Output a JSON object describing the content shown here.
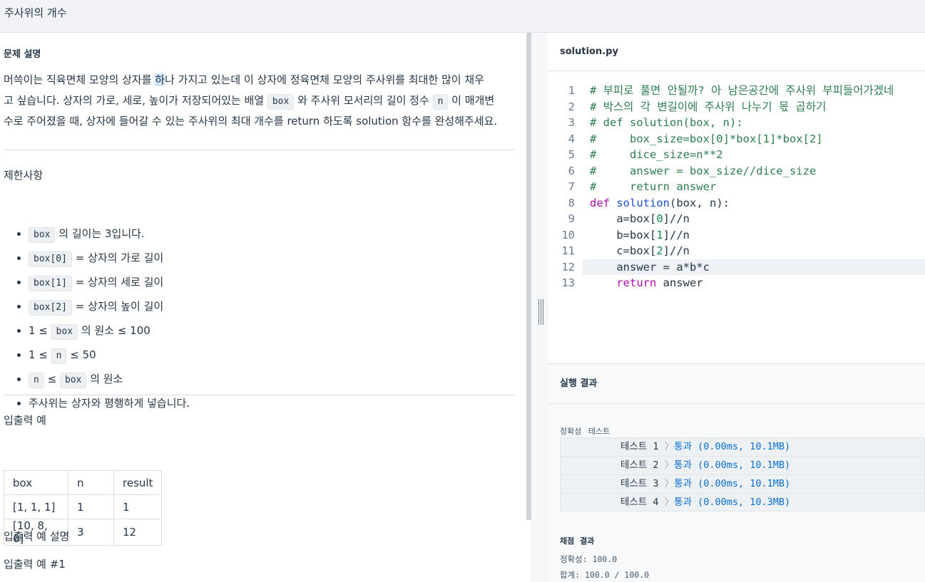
{
  "header": {
    "title": "주사위의 개수"
  },
  "problem": {
    "section_title": "문제 설명",
    "desc": {
      "p1a": "머쓱이는 직육면체 모양의 상자를 ",
      "p1hl": "하",
      "p1b": "나 가지고 있는데 이 상자에 정육면체 모양의 주사위를 최대한 많이 채우",
      "p2a": "고 싶습니다. 상자의 가로, 세로, 높이가 저장되어있는 배열 ",
      "p2code1": "box",
      "p2b": " 와 주사위 모서리의 길이 정수 ",
      "p2code2": "n",
      "p2c": " 이 매개변",
      "p3": "수로 주어졌을 때, 상자에 들어갈 수 있는 주사위의 최대 개수를 return 하도록 solution 함수를 완성해주세요."
    },
    "constraints_title": "제한사항",
    "constraints": {
      "c1_code": "box",
      "c1_text": " 의 길이는 3입니다.",
      "c2_code": "box[0]",
      "c2_text": " = 상자의 가로 길이",
      "c3_code": "box[1]",
      "c3_text": " = 상자의 세로 길이",
      "c4_code": "box[2]",
      "c4_text": " = 상자의 높이 길이",
      "c5_pre": "1 ≤ ",
      "c5_code": "box",
      "c5_text": " 의 원소 ≤ 100",
      "c6_pre": "1 ≤ ",
      "c6_code": "n",
      "c6_text": " ≤ 50",
      "c7_code1": "n",
      "c7_mid": " ≤ ",
      "c7_code2": "box",
      "c7_text": " 의 원소",
      "c8_text": "주사위는 상자와 평행하게 넣습니다."
    },
    "examples_title": "입출력 예",
    "examples": {
      "headers": [
        "box",
        "n",
        "result"
      ],
      "rows": [
        [
          "[1, 1, 1]",
          "1",
          "1"
        ],
        [
          "[10, 8, 6]",
          "3",
          "12"
        ]
      ]
    },
    "examples_desc_title": "입출력 예 설명",
    "example1_title": "입출력 예 #1"
  },
  "editor": {
    "filename": "solution.py",
    "lines": [
      {
        "n": "1",
        "t": "# 부피로 풀면 안될까? 아 남은공간에 주사위 부피들어가겠네"
      },
      {
        "n": "2",
        "t": "# 박스의 각 변길이에 주사위 나누기 몫 곱하기"
      },
      {
        "n": "3",
        "t": "# def solution(box, n):"
      },
      {
        "n": "4",
        "t": "#     box_size=box[0]*box[1]*box[2]"
      },
      {
        "n": "5",
        "t": "#     dice_size=n**2"
      },
      {
        "n": "6",
        "t": "#     answer = box_size//dice_size"
      },
      {
        "n": "7",
        "t": "#     return answer"
      },
      {
        "n": "8",
        "kw": "def",
        "fn": "solution",
        "rest": "(box, n):"
      },
      {
        "n": "9",
        "a": "    a=box[",
        "d": "0",
        "b": "]//n"
      },
      {
        "n": "10",
        "a": "    b=box[",
        "d": "1",
        "b": "]//n"
      },
      {
        "n": "11",
        "a": "    c=box[",
        "d": "2",
        "b": "]//n"
      },
      {
        "n": "12",
        "t": "    answer = a*b*c"
      },
      {
        "n": "13",
        "kw": "    return",
        "rest": " answer"
      }
    ]
  },
  "result": {
    "title": "실행 결과",
    "accuracy_label": "정확성 테스트",
    "tests": [
      {
        "name": "테스트 1",
        "arrow": "〉",
        "status": "통과 (0.00ms, 10.1MB)"
      },
      {
        "name": "테스트 2",
        "arrow": "〉",
        "status": "통과 (0.00ms, 10.1MB)"
      },
      {
        "name": "테스트 3",
        "arrow": "〉",
        "status": "통과 (0.00ms, 10.1MB)"
      },
      {
        "name": "테스트 4",
        "arrow": "〉",
        "status": "통과 (0.00ms, 10.3MB)"
      }
    ],
    "grade_title": "채점 결과",
    "grade_accuracy": "정확성: 100.0",
    "grade_total": "합계: 100.0 / 100.0"
  }
}
